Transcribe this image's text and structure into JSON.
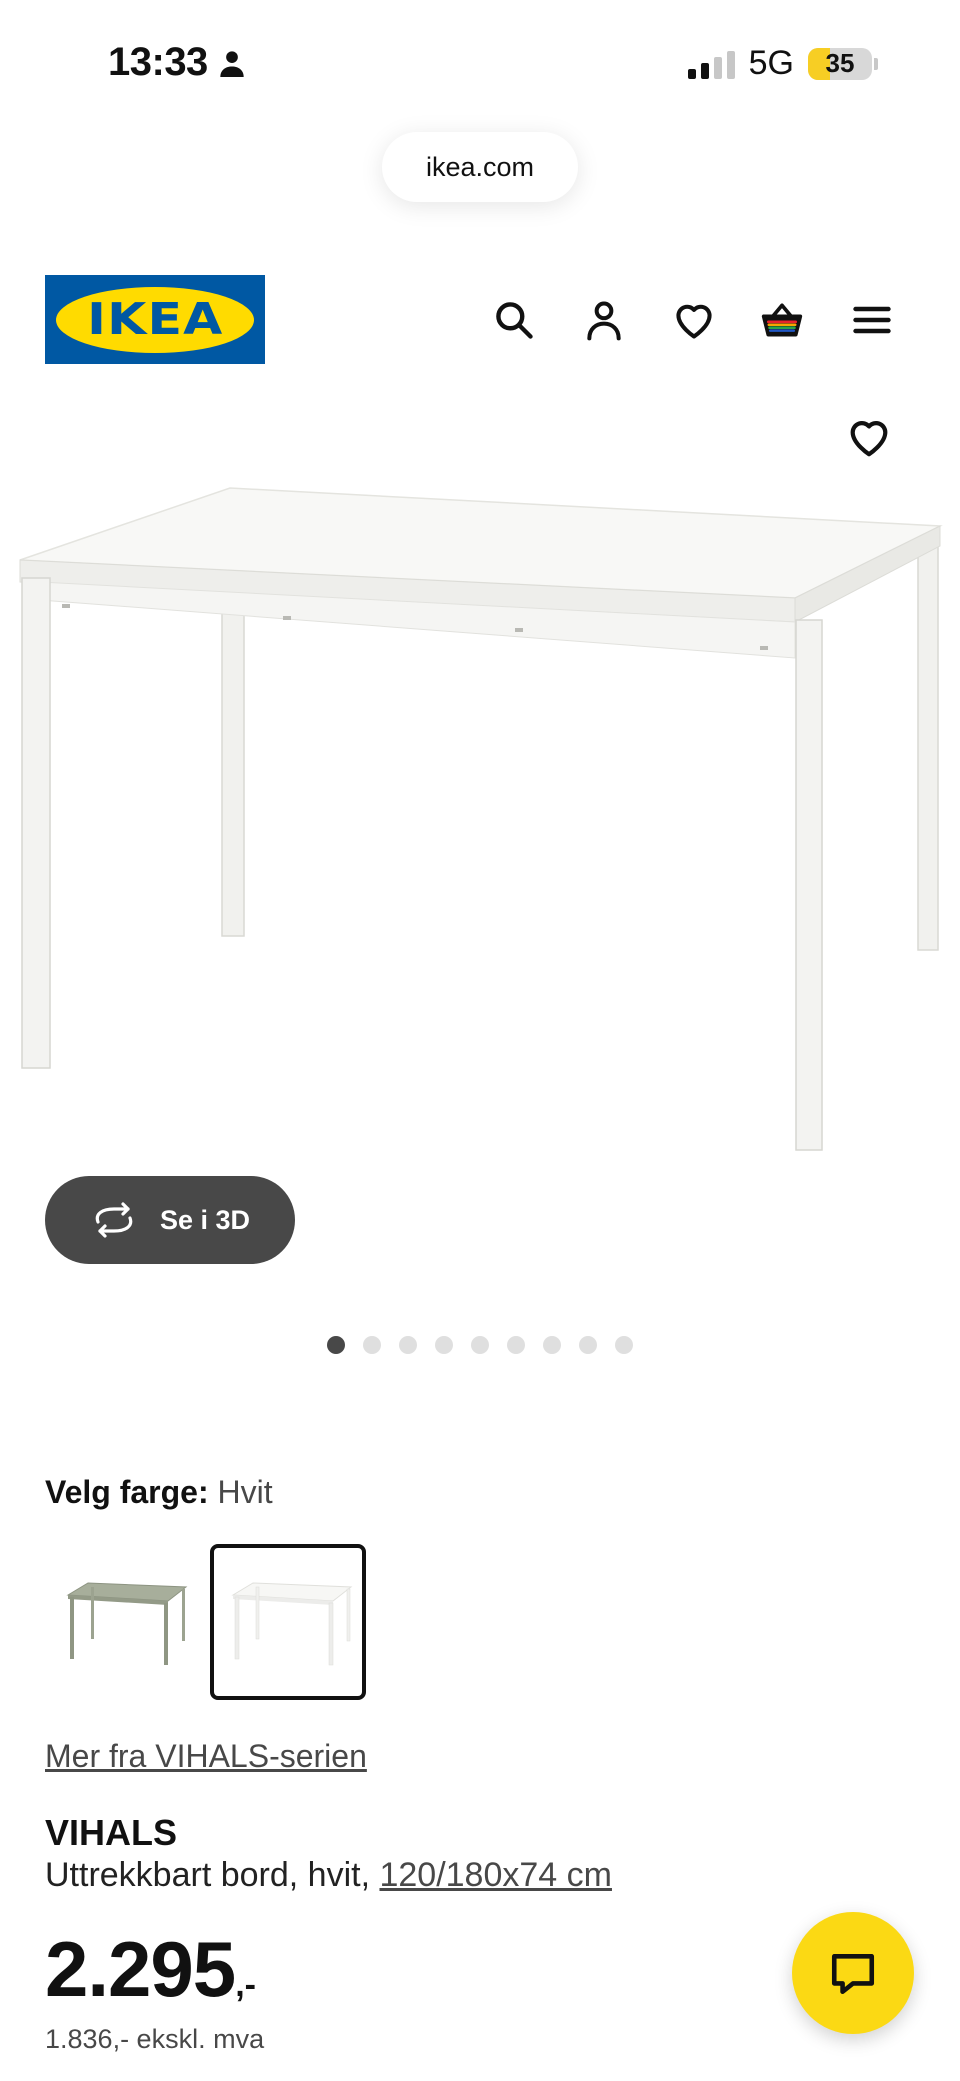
{
  "status_bar": {
    "time": "13:33",
    "network": "5G",
    "battery": "35",
    "battery_level_percent": 35
  },
  "browser": {
    "url": "ikea.com"
  },
  "header": {
    "logo_text": "IKEA",
    "brand_colors": {
      "blue": "#0058a3",
      "yellow": "#ffdb00"
    },
    "icons": [
      "search-icon",
      "account-icon",
      "heart-icon",
      "cart-icon",
      "menu-icon"
    ]
  },
  "gallery": {
    "view_3d_label": "Se i 3D",
    "image_count": 9,
    "active_index": 0
  },
  "color_picker": {
    "label": "Velg farge:",
    "selected_value": "Hvit",
    "options": [
      {
        "name": "grønn",
        "color": "#a3ab98",
        "selected": false
      },
      {
        "name": "Hvit",
        "color": "#f5f5f3",
        "selected": true
      }
    ]
  },
  "product": {
    "series_link": "Mer fra VIHALS-serien",
    "name": "VIHALS",
    "description": "Uttrekkbart bord, hvit, ",
    "size_link": "120/180x74 cm",
    "price": "2.295",
    "price_suffix": ",-",
    "price_ex_vat": "1.836,- ekskl. mva"
  },
  "chat": {
    "accent_color": "#fbd914"
  }
}
